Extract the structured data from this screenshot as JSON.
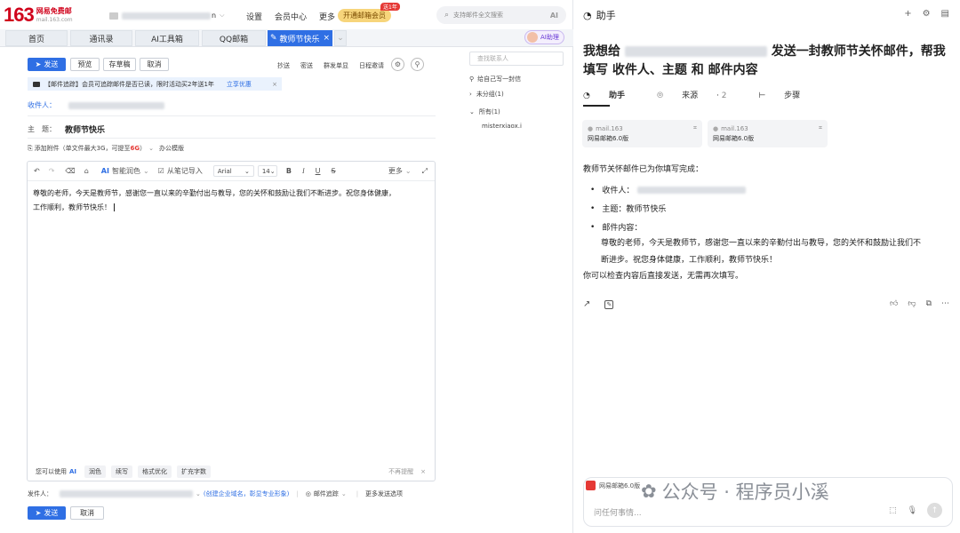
{
  "header": {
    "logo_num": "163",
    "logo_name": "网易免费邮",
    "logo_domain": "mail.163.com",
    "account_suffix": "n",
    "nav": [
      "设置",
      "会员中心",
      "更多"
    ],
    "vip_label": "开通邮箱会员",
    "vip_badge": "送1年",
    "search_placeholder": "支持邮件全文搜索",
    "search_ai": "AI"
  },
  "tabs": [
    {
      "label": "首页"
    },
    {
      "label": "通讯录"
    },
    {
      "label": "AI工具箱"
    },
    {
      "label": "QQ邮箱"
    },
    {
      "label": "教师节快乐"
    }
  ],
  "ai_help": "AI助理",
  "toolbar": {
    "send": "发送",
    "preview": "预览",
    "draft": "存草稿",
    "cancel": "取消",
    "options": [
      "抄送",
      "密送",
      "群发单显",
      "日程邀请"
    ]
  },
  "notice": {
    "text": "【邮件追踪】会员可追踪邮件是否已读，限时活动买2年送1年",
    "link": "立享优惠"
  },
  "compose": {
    "recipient_label": "收件人：",
    "subject_label": "主　题：",
    "subject_value": "教师节快乐",
    "attach": "添加附件（单文件最大3G，可提至",
    "attach_max": "6G",
    "attach_end": "）",
    "office": "办公模版"
  },
  "editor": {
    "polish": "智能润色",
    "import": "从笔记导入",
    "font": "Arial",
    "size": "14",
    "more": "更多",
    "body_line1": "尊敬的老师，今天是教师节，感谢您一直以来的辛勤付出与教导，您的关怀和鼓励让我们不断进步。祝您身体健康，",
    "body_line2": "工作顺利，教师节快乐！",
    "ai_hint": "您可以使用",
    "ai_word": "AI",
    "ai_chips": [
      "润色",
      "续写",
      "格式优化",
      "扩充字数"
    ],
    "no_remind": "不再提醒"
  },
  "footer": {
    "sender_label": "发件人：",
    "create_domain": "(创建企业域名，彰显专业形象)",
    "tracking": "邮件追踪",
    "more_options": "更多发送选项",
    "send": "发送",
    "cancel": "取消"
  },
  "contacts": {
    "search_placeholder": "查找联系人",
    "write_self": "给自己写一封信",
    "ungrouped": "未分组(1)",
    "all": "所有(1)",
    "entry": "misterxiaox.i"
  },
  "assistant": {
    "title": "助手",
    "question_prefix": "我想给",
    "question_suffix": "发送一封教师节关怀邮件，帮我填写 收件人、主题 和 邮件内容",
    "tabs": {
      "helper": "助手",
      "source": "来源",
      "source_count": "2",
      "steps": "步骤"
    },
    "sources": [
      {
        "site": "mail.163",
        "name": "网易邮箱6.0版"
      },
      {
        "site": "mail.163",
        "name": "网易邮箱6.0版"
      }
    ],
    "intro": "教师节关怀邮件已为你填写完成：",
    "recipient_label": "收件人：",
    "subject_label": "主题：",
    "subject_value": "教师节快乐",
    "content_label": "邮件内容：",
    "content_line1": "尊敬的老师，今天是教师节，感谢您一直以来的辛勤付出与教导，您的关怀和鼓励让我们不",
    "content_line2": "断进步。祝您身体健康，工作顺利，教师节快乐！",
    "closing": "你可以检查内容后直接发送，无需再次填写。",
    "attachment": "网易邮箱6.0版",
    "ask_placeholder": "问任何事情..."
  },
  "watermark": "公众号 · 程序员小溪"
}
